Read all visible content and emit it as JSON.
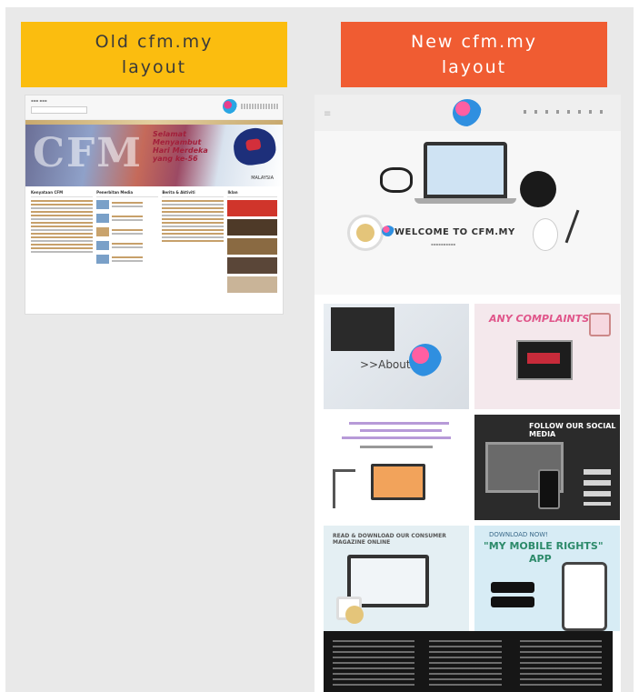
{
  "labels": {
    "old_line1": "Old cfm.my",
    "old_line2": "layout",
    "new_line1": "New cfm.my",
    "new_line2": "layout"
  },
  "colors": {
    "old_label_bg": "#fbbd0f",
    "new_label_bg": "#f05c32",
    "frame_bg": "#e9e9e9"
  },
  "old_site": {
    "banner_text": "CFM",
    "banner_message": "Selamat Menyambut Hari Merdeka yang ke-56",
    "banner_logo": "MALAYSIA",
    "columns": [
      "Kenyataan CFM",
      "Penerbitan Media",
      "Berita & Aktiviti",
      "Iklan"
    ]
  },
  "new_site": {
    "welcome_title": "WELCOME TO CFM.MY",
    "tile_about": ">>About",
    "tile_complaints": "ANY COMPLAINTS?",
    "tile_follow": "FOLLOW OUR SOCIAL MEDIA",
    "tile_magazine": "READ & DOWNLOAD OUR CONSUMER MAGAZINE ONLINE",
    "tile_app_top": "DOWNLOAD NOW!",
    "tile_app_title": "\"MY MOBILE RIGHTS\"",
    "tile_app_sub": "APP"
  }
}
